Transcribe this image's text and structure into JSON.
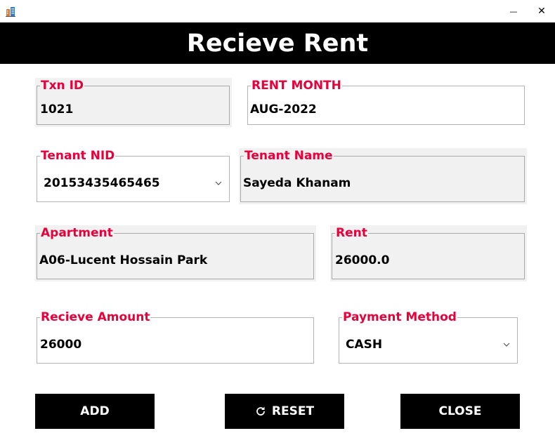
{
  "window": {
    "app_icon": "building-icon",
    "minimize_glyph": "—",
    "close_glyph": "✕"
  },
  "header": {
    "title": "Recieve Rent"
  },
  "fields": {
    "txn_id": {
      "label": "Txn ID",
      "value": "1021"
    },
    "rent_month": {
      "label": "RENT MONTH",
      "value": "AUG-2022"
    },
    "tenant_nid": {
      "label": "Tenant NID",
      "value": "20153435465465"
    },
    "tenant_name": {
      "label": "Tenant Name",
      "value": "Sayeda Khanam"
    },
    "apartment": {
      "label": "Apartment",
      "value": "A06-Lucent Hossain Park"
    },
    "rent": {
      "label": "Rent",
      "value": "26000.0"
    },
    "receive_amount": {
      "label": "Recieve Amount",
      "value": "26000"
    },
    "payment_method": {
      "label": "Payment Method",
      "value": "CASH"
    }
  },
  "buttons": {
    "add": "ADD",
    "reset": "RESET",
    "close": "CLOSE"
  },
  "colors": {
    "accent_label": "#e8003a",
    "banner_bg": "#000000",
    "readonly_bg": "#f1f1f1"
  }
}
